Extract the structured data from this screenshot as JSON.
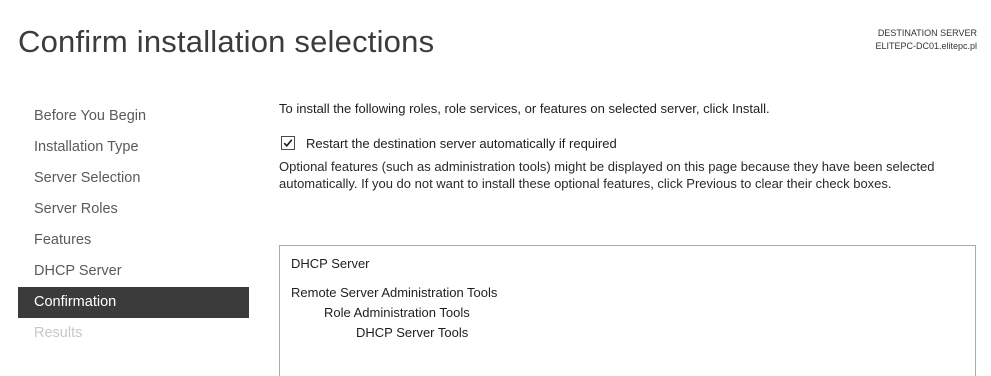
{
  "header": {
    "title": "Confirm installation selections",
    "destination_label": "DESTINATION SERVER",
    "destination_server": "ELITEPC-DC01.elitepc.pl"
  },
  "nav": {
    "items": [
      {
        "label": "Before You Begin",
        "state": "normal"
      },
      {
        "label": "Installation Type",
        "state": "normal"
      },
      {
        "label": "Server Selection",
        "state": "normal"
      },
      {
        "label": "Server Roles",
        "state": "normal"
      },
      {
        "label": "Features",
        "state": "normal"
      },
      {
        "label": "DHCP Server",
        "state": "normal"
      },
      {
        "label": "Confirmation",
        "state": "active"
      },
      {
        "label": "Results",
        "state": "disabled"
      }
    ]
  },
  "main": {
    "intro": "To install the following roles, role services, or features on selected server, click Install.",
    "restart_checkbox": {
      "label": "Restart the destination server automatically if required",
      "checked": true
    },
    "note": "Optional features (such as administration tools) might be displayed on this page because they have been selected automatically. If you do not want to install these optional features, click Previous to clear their check boxes.",
    "selections": [
      {
        "label": "DHCP Server",
        "level": 0
      },
      {
        "label": "Remote Server Administration Tools",
        "level": 0
      },
      {
        "label": "Role Administration Tools",
        "level": 1
      },
      {
        "label": "DHCP Server Tools",
        "level": 2
      }
    ]
  },
  "colors": {
    "active_nav_bg": "#3b3b3b",
    "disabled_nav_text": "#c8c8c8"
  }
}
